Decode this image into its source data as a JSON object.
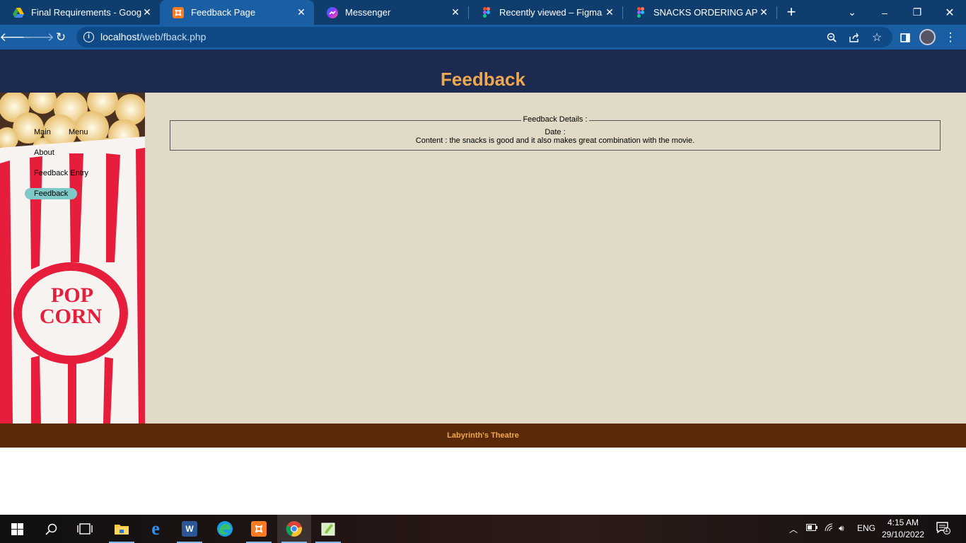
{
  "browser": {
    "tabs": [
      {
        "title": "Final Requirements - Google",
        "icon": "google-drive-icon",
        "color": "#34a853"
      },
      {
        "title": "Feedback Page",
        "icon": "xampp-icon",
        "color": "#fb7a24",
        "active": true
      },
      {
        "title": "Messenger",
        "icon": "messenger-icon",
        "color": "#a033ff"
      },
      {
        "title": "Recently viewed – Figma",
        "icon": "figma-icon",
        "color": "#f24e1e"
      },
      {
        "title": "SNACKS ORDERING APP FOR",
        "icon": "figma-icon",
        "color": "#f24e1e"
      }
    ],
    "url_host": "localhost",
    "url_path": "/web/fback.php"
  },
  "page": {
    "title": "Feedback",
    "menu": {
      "main": "Main",
      "menu": "Menu",
      "about": "About",
      "feedback_entry": "Feedback Entry",
      "feedback": "Feedback"
    },
    "feedback_details": {
      "legend": "Feedback Details :",
      "date_label": "Date :",
      "content_line": "Content : the snacks is good and it also makes great combination with the movie."
    },
    "sidebar_image_text": [
      "POP",
      "CORN"
    ],
    "footer": "Labyrinth's Theatre"
  },
  "taskbar": {
    "language": "ENG",
    "time": "4:15 AM",
    "date": "29/10/2022",
    "notification_count": "1"
  },
  "colors": {
    "header_bg": "#1b2a4e",
    "title": "#f0a850",
    "content_bg": "#e0dac6",
    "footer_bg": "#5a2a08",
    "active_menu": "#7ec9c8"
  }
}
